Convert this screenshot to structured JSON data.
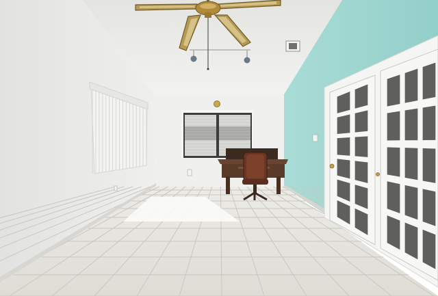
{
  "scene": {
    "kind": "interior-photo",
    "subject": "empty room",
    "elements": [
      "ceiling-fan",
      "vaulted-ceiling",
      "vertical-blinds",
      "back-window",
      "wooden-desk",
      "office-chair",
      "french-doors",
      "tile-floor",
      "sunlight-patch",
      "ceiling-vent",
      "thermostat",
      "light-switch",
      "wall-outlet"
    ]
  },
  "colors": {
    "ceiling": "#ededea",
    "left_wall": "#e9e9e7",
    "back_wall": "#f0f0ee",
    "accent_wall": "#9ed6d0",
    "floor": "#e4e2dc",
    "grout": "#c9c6bf",
    "baseboard": "#dcdad5",
    "door_frame": "#f5f5f3",
    "glass_pane": "#4a4a48",
    "fan_blade": "#b59a55",
    "fan_blade_edge": "#6f5a28",
    "fan_motor": "#b08a3a",
    "desk": "#5a3a28",
    "chair": "#6b3523",
    "blinds": "#f1f1ef",
    "sunlight": "#fbfbf8",
    "window_view": "#d8d8d4"
  }
}
